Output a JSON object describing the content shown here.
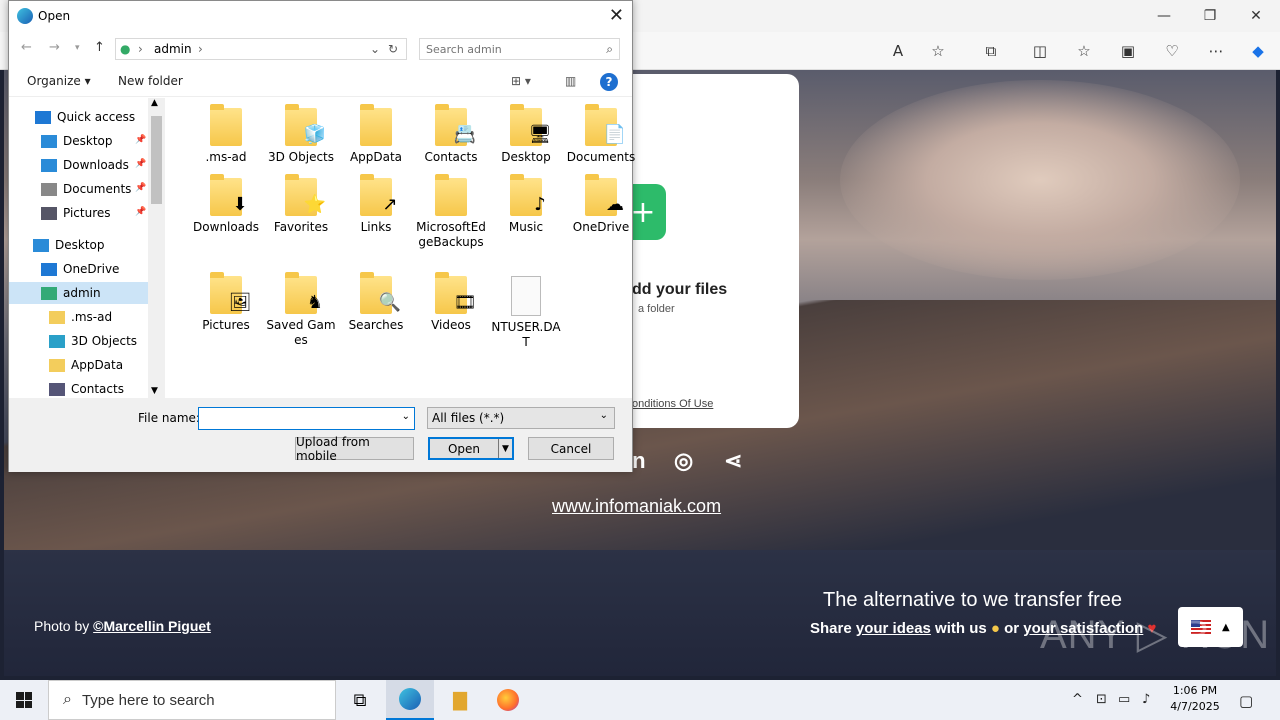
{
  "browser": {
    "window_controls": [
      "—",
      "❐",
      "✕"
    ]
  },
  "page": {
    "add_files": "dd your files",
    "add_folder": "a folder",
    "terms": "onditions Of Use",
    "site": "www.infomaniak.com",
    "alternative": "The alternative to we transfer free",
    "share_prefix": "Share ",
    "your_ideas": "your ideas",
    "with_us": " with us ",
    "or": " or ",
    "your_satisfaction": "your satisfaction",
    "photo_by": "Photo by ",
    "photographer": "©Marcellin Piguet",
    "watermark": "ANY ▷ RUN"
  },
  "dialog": {
    "title": "Open",
    "breadcrumb": [
      "admin"
    ],
    "search_placeholder": "Search admin",
    "organize": "Organize ▾",
    "new_folder": "New folder",
    "tree": [
      {
        "label": "Quick access",
        "icon": "star-icon",
        "pinned": false
      },
      {
        "label": "Desktop",
        "icon": "desktop-icon",
        "pinned": true
      },
      {
        "label": "Downloads",
        "icon": "download-icon",
        "pinned": true
      },
      {
        "label": "Documents",
        "icon": "document-icon",
        "pinned": true
      },
      {
        "label": "Pictures",
        "icon": "picture-icon",
        "pinned": true
      },
      {
        "label": "Desktop",
        "icon": "desktop-icon",
        "pinned": false
      },
      {
        "label": "OneDrive",
        "icon": "cloud-icon",
        "pinned": false
      },
      {
        "label": "admin",
        "icon": "user-icon",
        "pinned": false
      },
      {
        "label": ".ms-ad",
        "icon": "folder-icon",
        "pinned": false
      },
      {
        "label": "3D Objects",
        "icon": "cube-icon",
        "pinned": false
      },
      {
        "label": "AppData",
        "icon": "folder-icon",
        "pinned": false
      },
      {
        "label": "Contacts",
        "icon": "contacts-icon",
        "pinned": false
      }
    ],
    "files": [
      {
        "label": ".ms-ad",
        "type": "folder",
        "overlay": ""
      },
      {
        "label": "3D Objects",
        "type": "folder",
        "overlay": "🧊"
      },
      {
        "label": "AppData",
        "type": "folder",
        "overlay": ""
      },
      {
        "label": "Contacts",
        "type": "folder",
        "overlay": "📇"
      },
      {
        "label": "Desktop",
        "type": "folder",
        "overlay": "🖥"
      },
      {
        "label": "Documents",
        "type": "folder",
        "overlay": "📄"
      },
      {
        "label": "Downloads",
        "type": "folder",
        "overlay": "⬇"
      },
      {
        "label": "Favorites",
        "type": "folder",
        "overlay": "⭐"
      },
      {
        "label": "Links",
        "type": "folder",
        "overlay": "↗"
      },
      {
        "label": "MicrosoftEdgeBackups",
        "type": "folder",
        "overlay": ""
      },
      {
        "label": "Music",
        "type": "folder",
        "overlay": "♪"
      },
      {
        "label": "OneDrive",
        "type": "folder",
        "overlay": "☁"
      },
      {
        "label": "Pictures",
        "type": "folder",
        "overlay": "🖼"
      },
      {
        "label": "Saved Games",
        "type": "folder",
        "overlay": "♞"
      },
      {
        "label": "Searches",
        "type": "folder",
        "overlay": "🔍"
      },
      {
        "label": "Videos",
        "type": "folder",
        "overlay": "🎞"
      },
      {
        "label": "NTUSER.DAT",
        "type": "file",
        "overlay": ""
      }
    ],
    "file_name_label": "File name:",
    "file_name_value": "",
    "file_type": "All files (*.*)",
    "upload_mobile": "Upload from mobile",
    "open": "Open",
    "cancel": "Cancel"
  },
  "taskbar": {
    "search_placeholder": "Type here to search",
    "time": "1:06 PM",
    "date": "4/7/2025"
  }
}
